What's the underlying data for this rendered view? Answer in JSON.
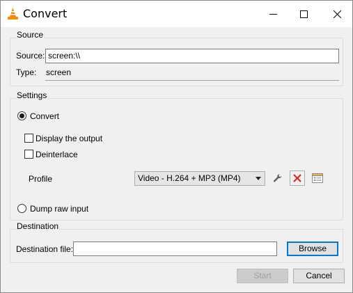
{
  "window": {
    "title": "Convert",
    "icon": "vlc-cone-icon"
  },
  "source": {
    "group_title": "Source",
    "source_label": "Source:",
    "source_value": "screen:\\\\",
    "type_label": "Type:",
    "type_value": "screen"
  },
  "settings": {
    "group_title": "Settings",
    "convert_label": "Convert",
    "convert_selected": true,
    "display_output_label": "Display the output",
    "deinterlace_label": "Deinterlace",
    "profile_label": "Profile",
    "profile_selected": "Video - H.264 + MP3 (MP4)",
    "dump_raw_label": "Dump raw input"
  },
  "destination": {
    "group_title": "Destination",
    "file_label": "Destination file:",
    "file_value": "",
    "browse_label": "Browse"
  },
  "footer": {
    "start_label": "Start",
    "cancel_label": "Cancel"
  },
  "colors": {
    "accent": "#0078d7",
    "delete_red": "#d81e1e",
    "cone_orange": "#f48b00"
  }
}
